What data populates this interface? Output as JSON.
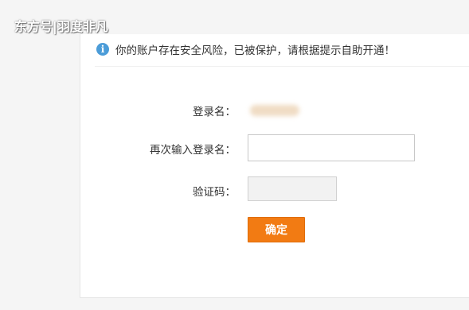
{
  "watermark": {
    "text": "东方号|羽度非凡"
  },
  "notice": {
    "icon": "info-icon",
    "icon_glyph": "i",
    "text": "你的账户存在安全风险，已被保护，请根据提示自助开通！"
  },
  "form": {
    "username_label": "登录名：",
    "username_value_redacted": true,
    "confirm_username_label": "再次输入登录名：",
    "confirm_username_value": "",
    "captcha_label": "验证码：",
    "captcha_value": "",
    "submit_label": "确定"
  },
  "colors": {
    "page_bg": "#f5f5f5",
    "panel_bg": "#ffffff",
    "accent": "#f27b13",
    "info_icon": "#4b9cd8",
    "text": "#333333"
  }
}
